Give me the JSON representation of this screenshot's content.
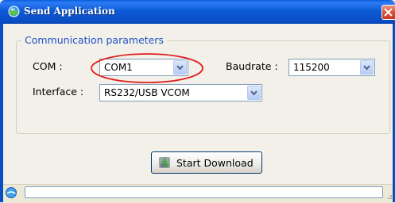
{
  "window": {
    "title": "Send Application",
    "icon": "app-globe-icon",
    "close_icon": "close-icon"
  },
  "group": {
    "legend": "Communication parameters"
  },
  "fields": {
    "com": {
      "label": "COM :",
      "value": "COM1",
      "highlighted": true
    },
    "baudrate": {
      "label": "Baudrate :",
      "value": "115200"
    },
    "interface": {
      "label": "Interface :",
      "value": "RS232/USB VCOM"
    }
  },
  "actions": {
    "start_download": {
      "label": "Start Download",
      "icon": "download-icon"
    }
  },
  "statusbar": {
    "icon": "status-globe-icon",
    "text": ""
  },
  "colors": {
    "titlebar": "#0A5EDB",
    "legend_text": "#2050C8",
    "highlight_ellipse": "#E02020",
    "close_button": "#D84E2E"
  }
}
